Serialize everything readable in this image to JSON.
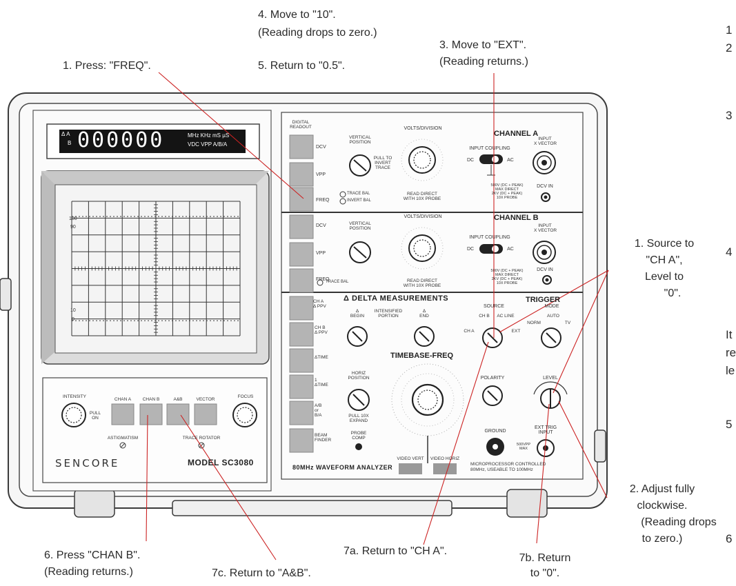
{
  "annotations": {
    "a1_press_freq": "1. Press: \"FREQ\".",
    "a4_move_10_l1": "4. Move to \"10\".",
    "a4_move_10_l2": "(Reading drops to zero.)",
    "a5_return_05": "5. Return to \"0.5\".",
    "a3_move_ext_l1": "3. Move to \"EXT\".",
    "a3_move_ext_l2": "(Reading returns.)",
    "a1_source_l1": "1. Source to",
    "a1_source_l2": "\"CH A\",",
    "a1_source_l3": "Level to",
    "a1_source_l4": "\"0\".",
    "a2_adjust_l1": "2. Adjust fully",
    "a2_adjust_l2": "clockwise.",
    "a2_adjust_l3": "(Reading drops",
    "a2_adjust_l4": "to zero.)",
    "a6_chanb_l1": "6. Press \"CHAN B\".",
    "a6_chanb_l2": "(Reading returns.)",
    "a7c": "7c. Return to \"A&B\".",
    "a7a": "7a. Return to \"CH A\".",
    "a7b_l1": "7b. Return",
    "a7b_l2": "to \"0\"."
  },
  "right_edge_fragments": [
    "1",
    "2",
    "3",
    "4",
    "It",
    "re",
    "le",
    "5",
    "6"
  ],
  "instrument": {
    "brand": "SENCORE",
    "model": "MODEL SC3080",
    "subtitle": "80MHz WAVEFORM ANALYZER",
    "micro_l1": "MICROPROCESSOR CONTROLLED",
    "micro_l2": "80MHz, USEABLE TO 100MHz",
    "display": {
      "digits": "000000",
      "prefix_top": "Δ A",
      "prefix_bot": "B",
      "units_top": "MHz KHz mS µS",
      "units_bot": "VDC VPP A/B/A"
    },
    "digital_readout": "DIGITAL\nREADOUT",
    "side_buttons_a": [
      "DCV",
      "VPP",
      "FREQ"
    ],
    "side_buttons_b": [
      "DCV",
      "VPP",
      "FREQ"
    ],
    "side_buttons_c": [
      "CH A\nΔ PPV",
      "CH B\nΔ PPV",
      "ΔTIME",
      "1\nΔTIME",
      "A/B\nor\nB/A",
      "BEAM\nFINDER"
    ],
    "channel_a": "CHANNEL A",
    "channel_b": "CHANNEL B",
    "volts_division": "VOLTS/DIVISION",
    "vertical_position": "VERTICAL\nPOSITION",
    "pull_invert": "PULL TO\nINVERT\nTRACE",
    "input_coupling": "INPUT COUPLING",
    "dc": "DC",
    "ac": "AC",
    "input_vector": "INPUT\nY VECTOR",
    "input_x_vector": "INPUT\nX VECTOR",
    "dcv_in": "DCV IN",
    "max_direct": "500V (DC + PEAK)\nMAX DIRECT\n2KV (DC + PEAK)\n10X PROBE",
    "read_direct": "READ DIRECT\nWITH 10X PROBE",
    "trace_bal": "TRACE BAL",
    "invert_bal": "INVERT BAL",
    "delta_measurements": "Δ DELTA MEASUREMENTS",
    "begin": "Δ\nBEGIN",
    "intensified": "INTENSIFIED\nPORTION",
    "end": "Δ\nEND",
    "trigger": "TRIGGER",
    "source": "SOURCE",
    "mode": "MODE",
    "src_cha": "CH A",
    "src_chb": "CH B",
    "src_acline": "AC LINE",
    "src_ext": "EXT",
    "mode_norm": "NORM",
    "mode_auto": "AUTO",
    "mode_tv": "TV",
    "timebase": "TIMEBASE-FREQ",
    "horiz_position": "HORIZ\nPOSITION",
    "pull_expand": "PULL 10X\nEXPAND",
    "probe_comp": "PROBE\nCOMP",
    "polarity": "POLARITY",
    "level": "LEVEL",
    "ground": "GROUND",
    "ext_trig": "EXT TRIG\nINPUT",
    "vpp_max": "500VPP\nMAX",
    "video_vert": "VIDEO VERT",
    "video_horiz": "VIDEO HORIZ",
    "intensity": "INTENSITY",
    "pull_on": "PULL\nON",
    "chan_a": "CHAN A",
    "chan_b": "CHAN B",
    "a_and_b": "A&B",
    "vector": "VECTOR",
    "focus": "FOCUS",
    "astigmatism": "ASTIGMATISM",
    "trace_rotator": "TRACE ROTATOR",
    "grat_100": "100",
    "grat_90": "90",
    "grat_10": "10",
    "grat_0": "0"
  }
}
